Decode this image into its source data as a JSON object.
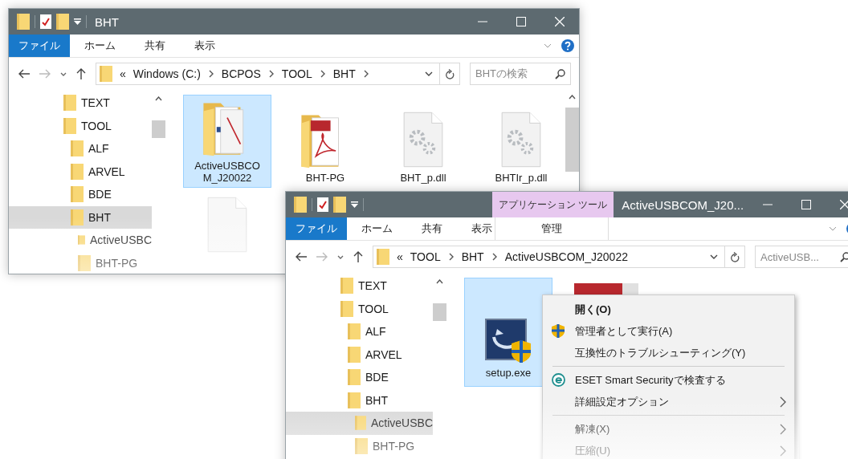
{
  "windows": [
    {
      "title": "BHT",
      "ribbon_tabs": [
        {
          "label": "ファイル",
          "selected": true
        },
        {
          "label": "ホーム",
          "selected": false
        },
        {
          "label": "共有",
          "selected": false
        },
        {
          "label": "表示",
          "selected": false
        }
      ],
      "address": {
        "overflow_mark": "«",
        "crumbs": [
          "Windows (C:)",
          "BCPOS",
          "TOOL",
          "BHT"
        ]
      },
      "search": {
        "placeholder": "BHTの検索"
      },
      "tree": [
        {
          "label": "TEXT",
          "selected": false
        },
        {
          "label": "TOOL",
          "selected": false,
          "children": [
            {
              "label": "ALF",
              "selected": false
            },
            {
              "label": "ARVEL",
              "selected": false
            },
            {
              "label": "BDE",
              "selected": false
            },
            {
              "label": "BHT",
              "selected": true,
              "children": [
                {
                  "label": "ActiveUSBC",
                  "selected": false
                },
                {
                  "label": "BHT-PG",
                  "selected": false
                }
              ]
            }
          ]
        }
      ],
      "files": [
        {
          "kind": "folder-docs",
          "name": "ActiveUSBCOM_J20022",
          "selected": true
        },
        {
          "kind": "folder-pdf",
          "name": "BHT-PG",
          "selected": false
        },
        {
          "kind": "dll",
          "name": "BHT_p.dll",
          "selected": false
        },
        {
          "kind": "dll",
          "name": "BHTIr_p.dll",
          "selected": false
        },
        {
          "kind": "blank",
          "selected": false
        }
      ]
    },
    {
      "title": "ActiveUSBCOM_J20...",
      "context_tab": {
        "label": "アプリケーション ツール",
        "subtab": "管理"
      },
      "ribbon_tabs": [
        {
          "label": "ファイル",
          "selected": true
        },
        {
          "label": "ホーム",
          "selected": false
        },
        {
          "label": "共有",
          "selected": false
        },
        {
          "label": "表示",
          "selected": false
        }
      ],
      "address": {
        "overflow_mark": "«",
        "crumbs": [
          "TOOL",
          "BHT",
          "ActiveUSBCOM_J20022"
        ]
      },
      "search": {
        "placeholder": "ActiveUSB..."
      },
      "tree": [
        {
          "label": "TEXT",
          "selected": false
        },
        {
          "label": "TOOL",
          "selected": false,
          "children": [
            {
              "label": "ALF",
              "selected": false
            },
            {
              "label": "ARVEL",
              "selected": false
            },
            {
              "label": "BDE",
              "selected": false
            },
            {
              "label": "BHT",
              "selected": false,
              "children": [
                {
                  "label": "ActiveUSBC",
                  "selected": true
                },
                {
                  "label": "BHT-PG",
                  "selected": false
                }
              ]
            }
          ]
        }
      ],
      "files": [
        {
          "kind": "exe",
          "name": "setup.exe",
          "selected": true
        },
        {
          "kind": "red-doc",
          "selected": false
        }
      ]
    }
  ],
  "context_menu": [
    {
      "kind": "item",
      "label": "開く(O)",
      "default": true,
      "submenu": false
    },
    {
      "kind": "admin-item",
      "label": "管理者として実行(A)",
      "default": false,
      "submenu": false
    },
    {
      "kind": "item",
      "label": "互換性のトラブルシューティング(Y)",
      "default": false,
      "submenu": false
    },
    {
      "kind": "separator"
    },
    {
      "kind": "scan-item",
      "label": "ESET Smart Securityで検査する",
      "default": false,
      "submenu": false
    },
    {
      "kind": "item",
      "label": "詳細設定オプション",
      "default": false,
      "submenu": true
    },
    {
      "kind": "separator"
    },
    {
      "kind": "item",
      "label": "解凍(X)",
      "default": false,
      "submenu": true
    },
    {
      "kind": "item",
      "label": "圧縮(U)",
      "default": false,
      "submenu": true
    }
  ]
}
